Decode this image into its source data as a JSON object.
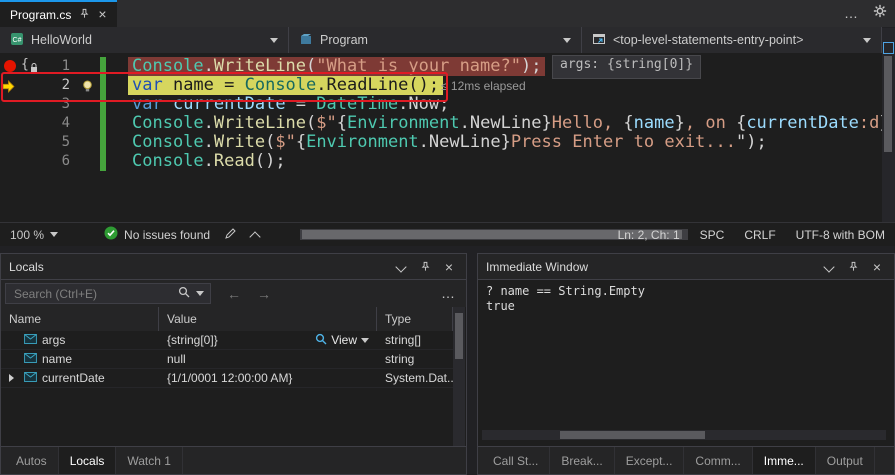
{
  "tab_bar": {
    "active_tab": "Program.cs"
  },
  "navbar": {
    "project": "HelloWorld",
    "type": "Program",
    "member": "<top-level-statements-entry-point>"
  },
  "editor": {
    "datatip": "args: {string[0]}",
    "perftip": "≤ 12ms elapsed",
    "lines": [
      {
        "num": "1",
        "hl": "breakpoint",
        "tokens": [
          [
            "Console",
            "cls"
          ],
          [
            ".",
            "pun"
          ],
          [
            "WriteLine",
            "mth"
          ],
          [
            "(",
            "pun"
          ],
          [
            "\"What is your name?\"",
            "str"
          ],
          [
            ");",
            "pun"
          ]
        ]
      },
      {
        "num": "2",
        "hl": "current",
        "tokens": [
          [
            "var",
            "kw2"
          ],
          [
            " name = ",
            "dk"
          ],
          [
            "Console",
            "cls2"
          ],
          [
            ".ReadLine();",
            "dk"
          ]
        ]
      },
      {
        "num": "3",
        "tokens": [
          [
            "var",
            "kw"
          ],
          [
            " ",
            "pun"
          ],
          [
            "currentDate",
            "var"
          ],
          [
            " = ",
            "pun"
          ],
          [
            "DateTime",
            "cls"
          ],
          [
            ".",
            "pun"
          ],
          [
            "Now",
            "pun"
          ],
          [
            ";",
            "pun"
          ]
        ]
      },
      {
        "num": "4",
        "tokens": [
          [
            "Console",
            "cls"
          ],
          [
            ".",
            "pun"
          ],
          [
            "WriteLine",
            "mth"
          ],
          [
            "(",
            "pun"
          ],
          [
            "$\"",
            "str"
          ],
          [
            "{",
            "pun"
          ],
          [
            "Environment",
            "cls"
          ],
          [
            ".",
            "pun"
          ],
          [
            "NewLine",
            "pun"
          ],
          [
            "}",
            "pun"
          ],
          [
            "Hello, ",
            "str"
          ],
          [
            "{",
            "pun"
          ],
          [
            "name",
            "var"
          ],
          [
            "}",
            "pun"
          ],
          [
            ", on ",
            "str"
          ],
          [
            "{",
            "pun"
          ],
          [
            "currentDate",
            "var"
          ],
          [
            ":d",
            "str"
          ],
          [
            "}",
            "pun"
          ]
        ]
      },
      {
        "num": "5",
        "tokens": [
          [
            "Console",
            "cls"
          ],
          [
            ".",
            "pun"
          ],
          [
            "Write",
            "mth"
          ],
          [
            "(",
            "pun"
          ],
          [
            "$\"",
            "str"
          ],
          [
            "{",
            "pun"
          ],
          [
            "Environment",
            "cls"
          ],
          [
            ".",
            "pun"
          ],
          [
            "NewLine",
            "pun"
          ],
          [
            "}",
            "pun"
          ],
          [
            "Press Enter to exit...",
            "str"
          ],
          [
            "\");",
            "pun"
          ]
        ]
      },
      {
        "num": "6",
        "tokens": [
          [
            "Console",
            "cls"
          ],
          [
            ".",
            "pun"
          ],
          [
            "Read",
            "mth"
          ],
          [
            "();",
            "pun"
          ]
        ]
      }
    ]
  },
  "status_bar": {
    "zoom": "100 %",
    "issues": "No issues found",
    "line_col": "Ln: 2, Ch: 1",
    "spaces": "SPC",
    "line_ending": "CRLF",
    "encoding": "UTF-8 with BOM"
  },
  "locals": {
    "title": "Locals",
    "search_placeholder": "Search (Ctrl+E)",
    "columns": [
      "Name",
      "Value",
      "Type"
    ],
    "rows": [
      {
        "expandable": false,
        "name": "args",
        "value": "{string[0]}",
        "view": "View",
        "type": "string[]"
      },
      {
        "expandable": false,
        "name": "name",
        "value": "null",
        "view": "",
        "type": "string"
      },
      {
        "expandable": true,
        "name": "currentDate",
        "value": "{1/1/0001 12:00:00 AM}",
        "view": "",
        "type": "System.Dat..."
      }
    ],
    "tabs": [
      {
        "label": "Autos",
        "active": false
      },
      {
        "label": "Locals",
        "active": true
      },
      {
        "label": "Watch 1",
        "active": false
      }
    ]
  },
  "immediate": {
    "title": "Immediate Window",
    "lines": [
      "? name == String.Empty",
      "true"
    ],
    "tabs": [
      {
        "label": "Call St...",
        "active": false
      },
      {
        "label": "Break...",
        "active": false
      },
      {
        "label": "Except...",
        "active": false
      },
      {
        "label": "Comm...",
        "active": false
      },
      {
        "label": "Imme...",
        "active": true
      },
      {
        "label": "Output",
        "active": false
      }
    ]
  },
  "colors": {
    "accent_blue": "#1C97EA",
    "breakpoint_red": "#E51400",
    "current_line_yellow": "#D6D65E",
    "breakpoint_line_bg": "#7E3A35",
    "change_bar_green": "#45A43C",
    "check_green": "#2E9B33",
    "annotation_red": "#E01B24"
  }
}
